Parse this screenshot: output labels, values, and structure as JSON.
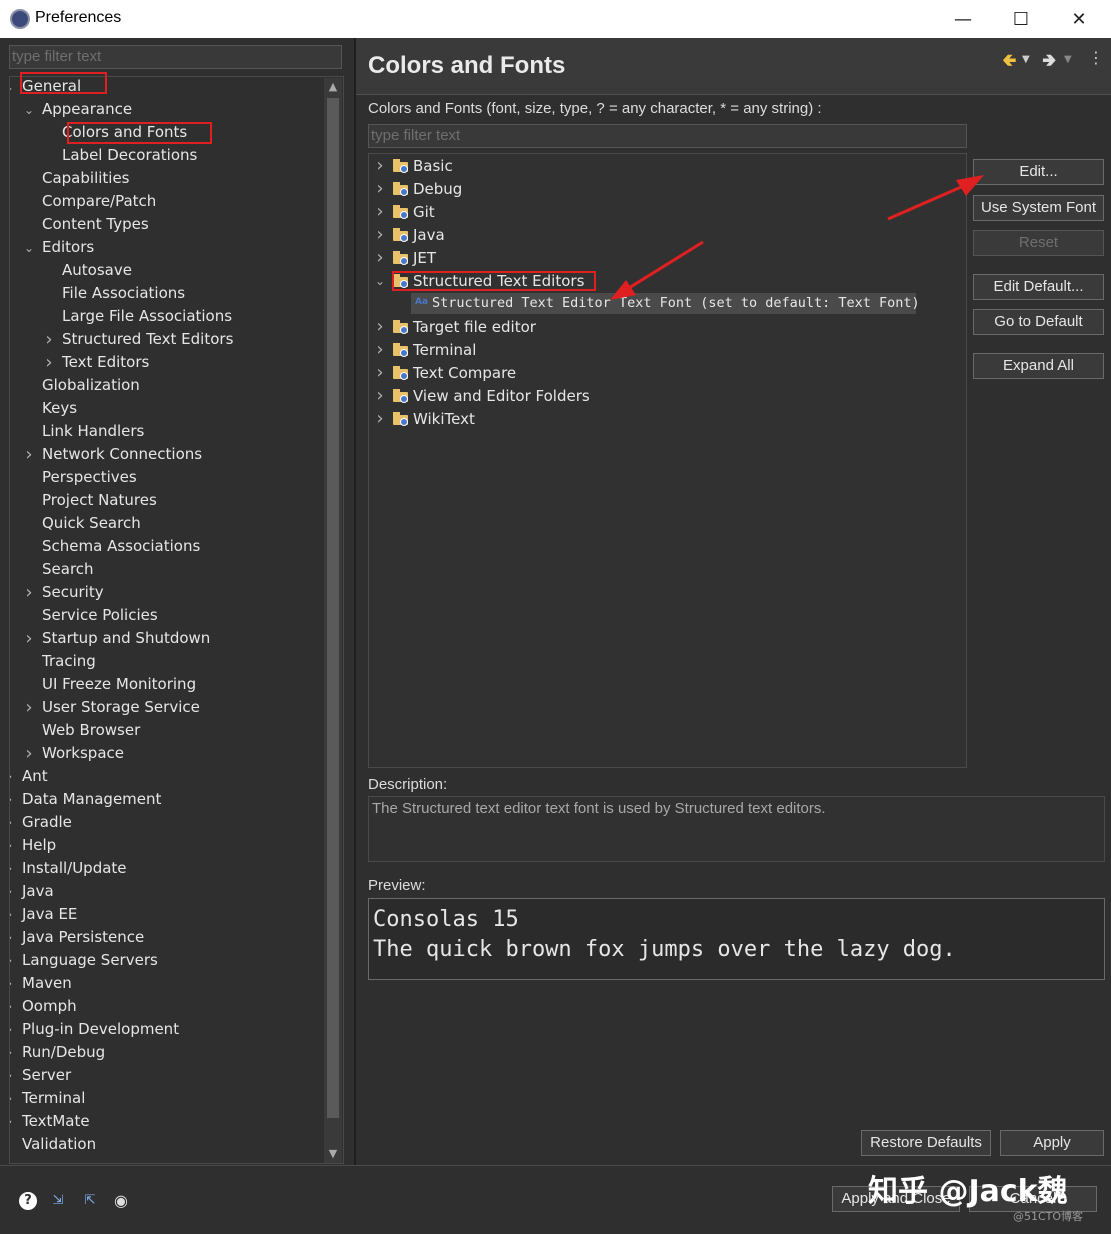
{
  "window": {
    "title": "Preferences"
  },
  "left": {
    "filter_placeholder": "type filter text",
    "tree": [
      {
        "label": "General",
        "depth": 0,
        "chev": "down"
      },
      {
        "label": "Appearance",
        "depth": 1,
        "chev": "down"
      },
      {
        "label": "Colors and Fonts",
        "depth": 2,
        "chev": ""
      },
      {
        "label": "Label Decorations",
        "depth": 2,
        "chev": ""
      },
      {
        "label": "Capabilities",
        "depth": 1,
        "chev": ""
      },
      {
        "label": "Compare/Patch",
        "depth": 1,
        "chev": ""
      },
      {
        "label": "Content Types",
        "depth": 1,
        "chev": ""
      },
      {
        "label": "Editors",
        "depth": 1,
        "chev": "down"
      },
      {
        "label": "Autosave",
        "depth": 2,
        "chev": ""
      },
      {
        "label": "File Associations",
        "depth": 2,
        "chev": ""
      },
      {
        "label": "Large File Associations",
        "depth": 2,
        "chev": ""
      },
      {
        "label": "Structured Text Editors",
        "depth": 2,
        "chev": "right"
      },
      {
        "label": "Text Editors",
        "depth": 2,
        "chev": "right"
      },
      {
        "label": "Globalization",
        "depth": 1,
        "chev": ""
      },
      {
        "label": "Keys",
        "depth": 1,
        "chev": ""
      },
      {
        "label": "Link Handlers",
        "depth": 1,
        "chev": ""
      },
      {
        "label": "Network Connections",
        "depth": 1,
        "chev": "right"
      },
      {
        "label": "Perspectives",
        "depth": 1,
        "chev": ""
      },
      {
        "label": "Project Natures",
        "depth": 1,
        "chev": ""
      },
      {
        "label": "Quick Search",
        "depth": 1,
        "chev": ""
      },
      {
        "label": "Schema Associations",
        "depth": 1,
        "chev": ""
      },
      {
        "label": "Search",
        "depth": 1,
        "chev": ""
      },
      {
        "label": "Security",
        "depth": 1,
        "chev": "right"
      },
      {
        "label": "Service Policies",
        "depth": 1,
        "chev": ""
      },
      {
        "label": "Startup and Shutdown",
        "depth": 1,
        "chev": "right"
      },
      {
        "label": "Tracing",
        "depth": 1,
        "chev": ""
      },
      {
        "label": "UI Freeze Monitoring",
        "depth": 1,
        "chev": ""
      },
      {
        "label": "User Storage Service",
        "depth": 1,
        "chev": "right"
      },
      {
        "label": "Web Browser",
        "depth": 1,
        "chev": ""
      },
      {
        "label": "Workspace",
        "depth": 1,
        "chev": "right"
      },
      {
        "label": "Ant",
        "depth": 0,
        "chev": "right"
      },
      {
        "label": "Data Management",
        "depth": 0,
        "chev": "right"
      },
      {
        "label": "Gradle",
        "depth": 0,
        "chev": "right"
      },
      {
        "label": "Help",
        "depth": 0,
        "chev": "right"
      },
      {
        "label": "Install/Update",
        "depth": 0,
        "chev": "right"
      },
      {
        "label": "Java",
        "depth": 0,
        "chev": "right"
      },
      {
        "label": "Java EE",
        "depth": 0,
        "chev": "right"
      },
      {
        "label": "Java Persistence",
        "depth": 0,
        "chev": "right"
      },
      {
        "label": "Language Servers",
        "depth": 0,
        "chev": "right"
      },
      {
        "label": "Maven",
        "depth": 0,
        "chev": "right"
      },
      {
        "label": "Oomph",
        "depth": 0,
        "chev": "right"
      },
      {
        "label": "Plug-in Development",
        "depth": 0,
        "chev": "right"
      },
      {
        "label": "Run/Debug",
        "depth": 0,
        "chev": "right"
      },
      {
        "label": "Server",
        "depth": 0,
        "chev": "right"
      },
      {
        "label": "Terminal",
        "depth": 0,
        "chev": "right"
      },
      {
        "label": "TextMate",
        "depth": 0,
        "chev": "right"
      },
      {
        "label": "Validation",
        "depth": 0,
        "chev": ""
      }
    ]
  },
  "right": {
    "title": "Colors and Fonts",
    "intro": "Colors and Fonts (font, size, type, ? = any character, * = any string) :",
    "filter_placeholder": "type filter text",
    "tree": [
      {
        "label": "Basic",
        "chev": "right"
      },
      {
        "label": "Debug",
        "chev": "right"
      },
      {
        "label": "Git",
        "chev": "right"
      },
      {
        "label": "Java",
        "chev": "right"
      },
      {
        "label": "JET",
        "chev": "right"
      },
      {
        "label": "Structured Text Editors",
        "chev": "down"
      },
      {
        "label": "Structured Text Editor Text Font (set to default: Text Font)",
        "chev": "",
        "child": true
      },
      {
        "label": "Target file editor",
        "chev": "right"
      },
      {
        "label": "Terminal",
        "chev": "right"
      },
      {
        "label": "Text Compare",
        "chev": "right"
      },
      {
        "label": "View and Editor Folders",
        "chev": "right"
      },
      {
        "label": "WikiText",
        "chev": "right"
      }
    ],
    "buttons": {
      "edit": "Edit...",
      "use_system_font": "Use System Font",
      "reset": "Reset",
      "edit_default": "Edit Default...",
      "go_to_default": "Go to Default",
      "expand_all": "Expand All"
    },
    "description_label": "Description:",
    "description_text": "The Structured text editor text font is used by Structured text editors.",
    "preview_label": "Preview:",
    "preview_line1": "Consolas 15",
    "preview_line2": "The quick brown fox jumps over the lazy dog.",
    "restore_defaults": "Restore Defaults",
    "apply": "Apply"
  },
  "footer": {
    "apply_and_close": "Apply and Close",
    "cancel": "Cancel"
  },
  "watermark": {
    "text": "知乎 @Jack魏",
    "small": "@51CTO博客"
  },
  "colors": {
    "highlight_box": "#e02020",
    "folder": "#e8c26a",
    "background": "#2f2f2f"
  }
}
